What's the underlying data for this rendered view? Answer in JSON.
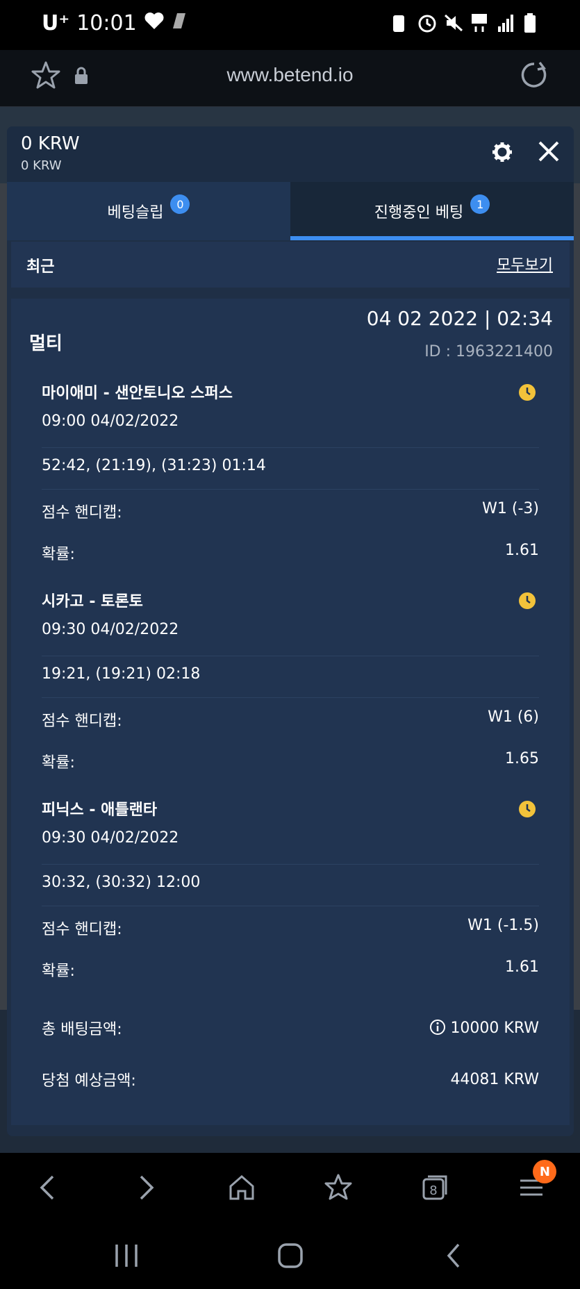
{
  "status": {
    "carrier": "U⁺",
    "time": "10:01"
  },
  "browser": {
    "url": "www.betend.io",
    "tab_count": "8",
    "notification_badge": "N"
  },
  "modal": {
    "balance_main": "0 KRW",
    "balance_sub": "0 KRW",
    "tabs": [
      {
        "label": "베팅슬립",
        "count": "0"
      },
      {
        "label": "진행중인 베팅",
        "count": "1"
      }
    ],
    "recent_label": "최근",
    "view_all": "모두보기",
    "bet": {
      "type": "멀티",
      "date": "04 02 2022 | 02:34",
      "id": "ID :  1963221400",
      "matches": [
        {
          "name": "마이애미 - 샌안토니오 스퍼스",
          "time": "09:00   04/02/2022",
          "score": "52:42, (21:19), (31:23) 01:14",
          "handicap_label": "점수 핸디캡:",
          "handicap_value": "W1 (-3)",
          "odds_label": "확률:",
          "odds_value": "1.61"
        },
        {
          "name": "시카고 - 토론토",
          "time": "09:30   04/02/2022",
          "score": "19:21, (19:21) 02:18",
          "handicap_label": "점수 핸디캡:",
          "handicap_value": "W1 (6)",
          "odds_label": "확률:",
          "odds_value": "1.65"
        },
        {
          "name": "피닉스 - 애틀랜타",
          "time": "09:30   04/02/2022",
          "score": "30:32, (30:32) 12:00",
          "handicap_label": "점수 핸디캡:",
          "handicap_value": "W1 (-1.5)",
          "odds_label": "확률:",
          "odds_value": "1.61"
        }
      ],
      "total_stake_label": "총 배팅금액:",
      "total_stake_value": "10000 KRW",
      "potential_win_label": "당첨 예상금액:",
      "potential_win_value": "44081 KRW"
    }
  },
  "colors": {
    "accent": "#3d8ef0",
    "clock": "#f2c23a",
    "modal_bg": "#1f2f46"
  }
}
